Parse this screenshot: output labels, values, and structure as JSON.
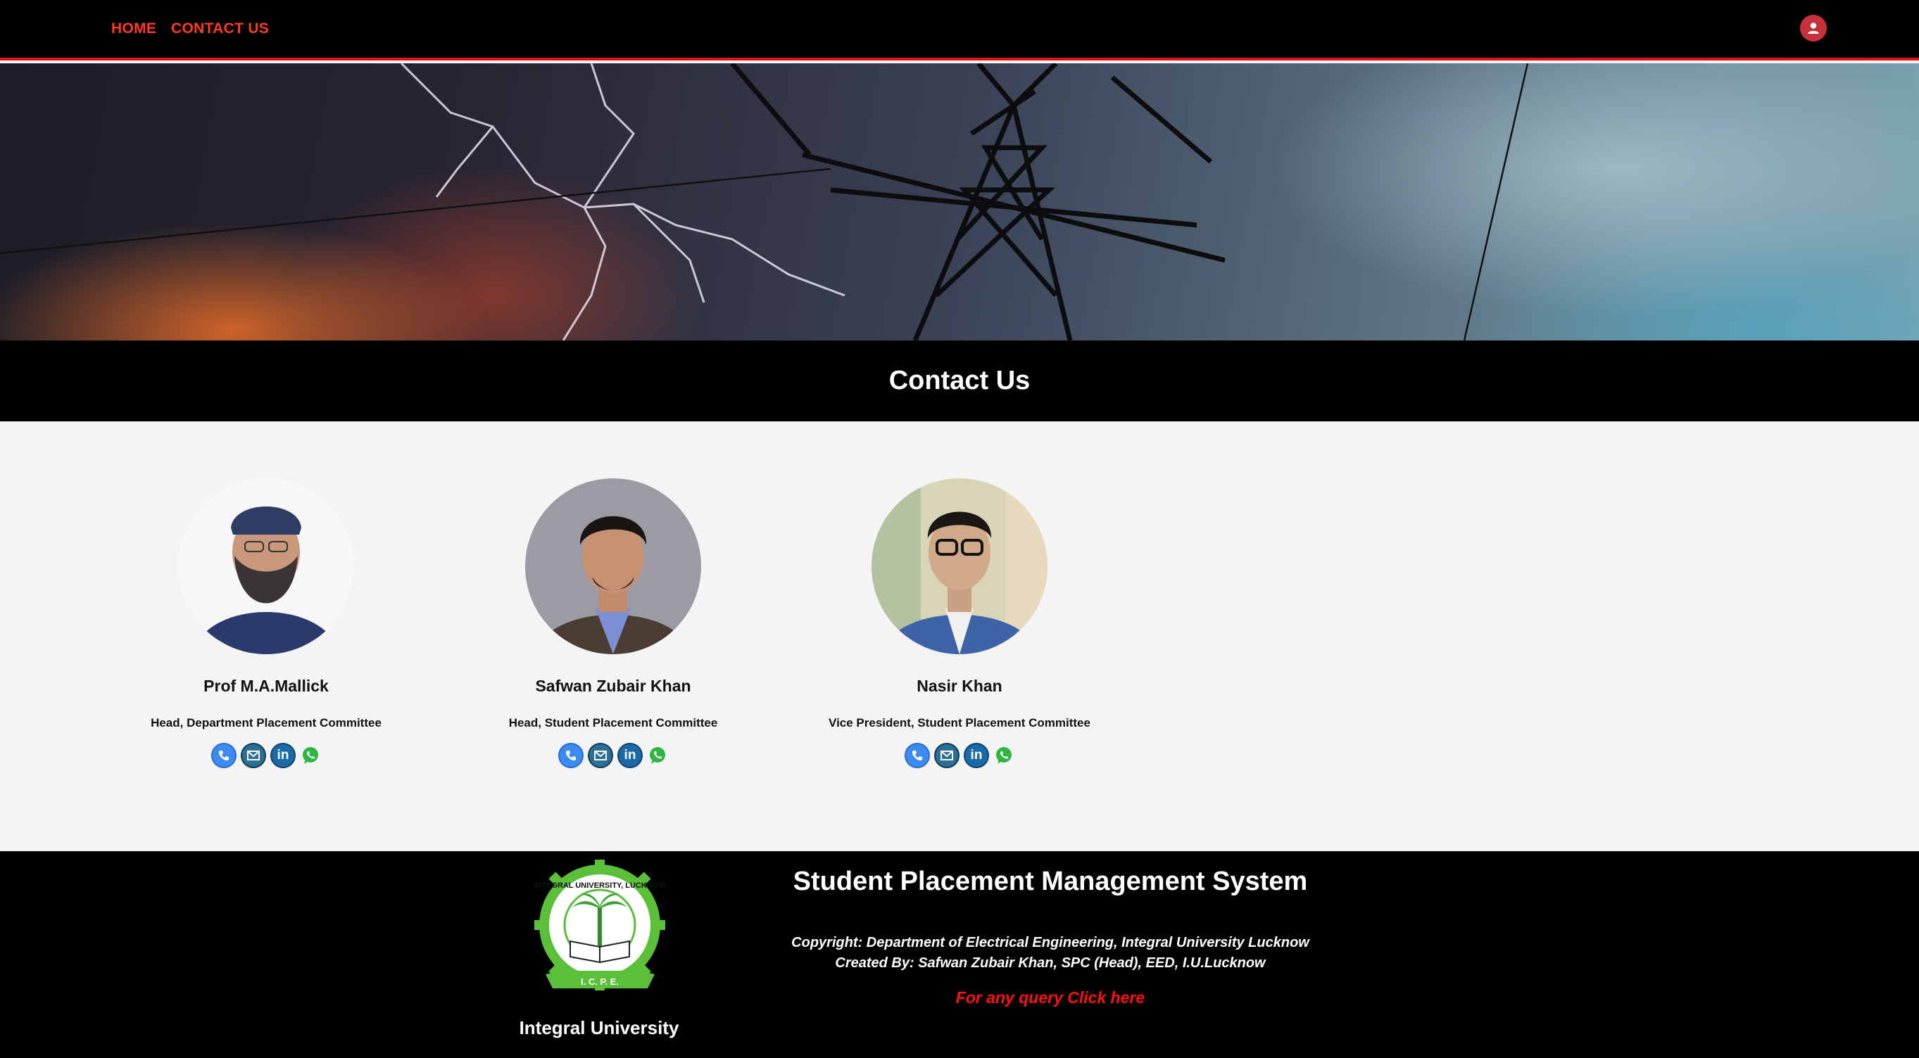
{
  "nav": {
    "items": [
      {
        "label": "HOME"
      },
      {
        "label": "CONTACT US"
      }
    ],
    "user_icon": "user-icon",
    "accent_color": "#ff3b1f",
    "border_color": "#e01212"
  },
  "hero": {
    "image": "power-tower-lightning-banner"
  },
  "page_title": "Contact Us",
  "contacts": [
    {
      "name": "Prof M.A.Mallick",
      "role": "Head, Department Placement Committee",
      "icons": [
        "phone-icon",
        "email-icon",
        "linkedin-icon",
        "whatsapp-icon"
      ]
    },
    {
      "name": "Safwan Zubair Khan",
      "role": "Head, Student Placement Committee",
      "icons": [
        "phone-icon",
        "email-icon",
        "linkedin-icon",
        "whatsapp-icon"
      ]
    },
    {
      "name": "Nasir Khan",
      "role": "Vice President, Student Placement Committee",
      "icons": [
        "phone-icon",
        "email-icon",
        "linkedin-icon",
        "whatsapp-icon"
      ]
    }
  ],
  "footer": {
    "logo_name": "integral-university-logo",
    "logo_text": "INTEGRAL UNIVERSITY, LUCKNOW",
    "logo_banner": "I. C. P. E.",
    "university": "Integral University",
    "system_title": "Student Placement Management System",
    "copyright": "Copyright: Department of Electrical Engineering, Integral University Lucknow",
    "created_by": "Created By: Safwan Zubair Khan, SPC (Head), EED, I.U.Lucknow",
    "query_link": "For any query Click here",
    "query_color": "#ff1010"
  }
}
